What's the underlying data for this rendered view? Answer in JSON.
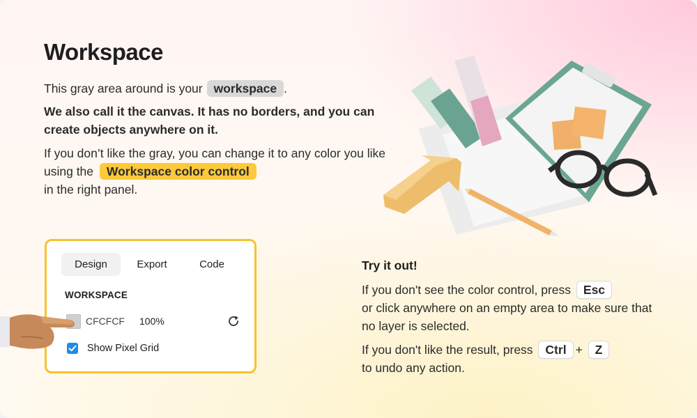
{
  "title": "Workspace",
  "intro": {
    "line1_before": "This gray area around is your",
    "line1_chip": "workspace",
    "line1_after": ".",
    "line2": "We also call it the canvas. It has no borders, and you can create objects anywhere on it.",
    "line3_before": "If you don’t like the gray, you can change it to any color you like using the",
    "line3_chip": "Workspace color control",
    "line3_after": "in the right panel."
  },
  "panel": {
    "tabs": [
      "Design",
      "Export",
      "Code"
    ],
    "active_tab": "Design",
    "section_label": "WORKSPACE",
    "color_hex": "CFCFCF",
    "color_swatch": "#cfcfcf",
    "opacity": "100%",
    "show_pixel_grid_label": "Show Pixel Grid",
    "show_pixel_grid_checked": true,
    "icons": [
      "reset-icon",
      "checkbox-checked-icon",
      "pointing-hand-icon"
    ]
  },
  "try": {
    "title": "Try it out!",
    "p1_before": "If you don't see the color control, press",
    "p1_key": "Esc",
    "p1_after": "or click anywhere on an empty area to make sure that no layer is selected.",
    "p2_before": "If you don't like the result, press",
    "p2_key1": "Ctrl",
    "p2_plus": "+",
    "p2_key2": "Z",
    "p2_after": "to undo any action."
  },
  "colors": {
    "accent_yellow": "#fcc93a",
    "panel_border": "#f8c22d",
    "checkbox_blue": "#1f8ce6",
    "chip_gray": "#d8d8d8"
  }
}
